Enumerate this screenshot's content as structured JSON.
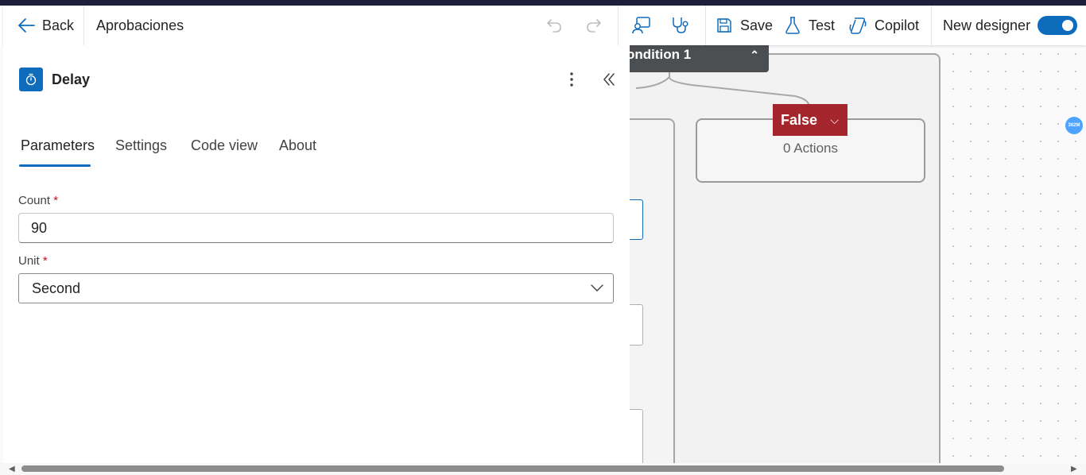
{
  "toolbar": {
    "back_label": "Back",
    "flow_name": "Aprobaciones",
    "save_label": "Save",
    "test_label": "Test",
    "copilot_label": "Copilot",
    "new_designer_label": "New designer",
    "new_designer_enabled": true
  },
  "panel": {
    "title": "Delay",
    "tabs": [
      {
        "label": "Parameters",
        "active": true
      },
      {
        "label": "Settings",
        "active": false
      },
      {
        "label": "Code view",
        "active": false
      },
      {
        "label": "About",
        "active": false
      }
    ],
    "count_label": "Count",
    "count_value": "90",
    "unit_label": "Unit",
    "unit_value": "Second",
    "required_marker": "*"
  },
  "canvas": {
    "condition_label": "ondition 1",
    "false_branch_label": "False",
    "false_actions_text": "0 Actions",
    "zoom_badge": "362M"
  },
  "colors": {
    "accent": "#0f6cbd",
    "false_branch": "#a4262c",
    "condition_header": "#4c4f52"
  }
}
